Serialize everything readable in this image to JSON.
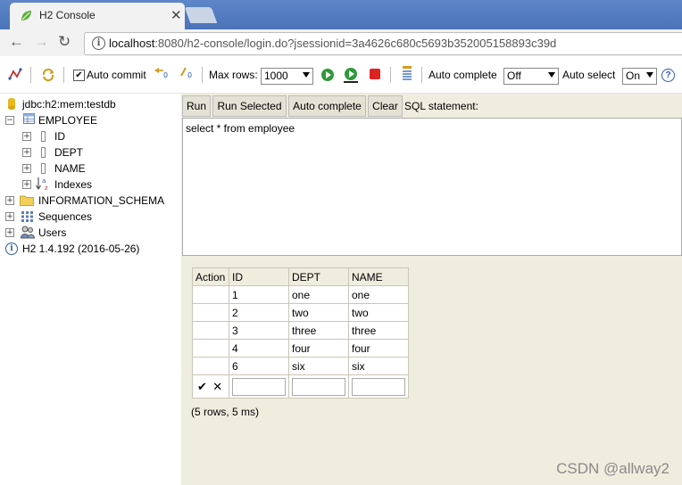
{
  "browser": {
    "tab_title": "H2 Console",
    "url_host": "localhost",
    "url_rest": ":8080/h2-console/login.do?jsessionid=3a4626c680c5693b352005158893c39d"
  },
  "toolbar": {
    "auto_commit_label": "Auto commit",
    "max_rows_label": "Max rows:",
    "max_rows_value": "1000",
    "auto_complete_label": "Auto complete",
    "auto_complete_value": "Off",
    "auto_select_label": "Auto select",
    "auto_select_value": "On",
    "help_glyph": "?"
  },
  "tree": {
    "connection": "jdbc:h2:mem:testdb",
    "table": "EMPLOYEE",
    "columns": [
      "ID",
      "DEPT",
      "NAME"
    ],
    "indexes": "Indexes",
    "info_schema": "INFORMATION_SCHEMA",
    "sequences": "Sequences",
    "users": "Users",
    "version": "H2 1.4.192 (2016-05-26)"
  },
  "editor": {
    "run": "Run",
    "run_selected": "Run Selected",
    "auto_complete": "Auto complete",
    "clear": "Clear",
    "sql_label": "SQL statement:",
    "sql_text": "select * from employee"
  },
  "result": {
    "headers": [
      "Action",
      "ID",
      "DEPT",
      "NAME"
    ],
    "rows": [
      [
        "1",
        "one",
        "one"
      ],
      [
        "2",
        "two",
        "two"
      ],
      [
        "3",
        "three",
        "three"
      ],
      [
        "4",
        "four",
        "four"
      ],
      [
        "6",
        "six",
        "six"
      ]
    ],
    "ok_glyph": "✔",
    "cancel_glyph": "✕",
    "summary": "(5 rows, 5 ms)"
  },
  "watermark": "CSDN @allway2"
}
